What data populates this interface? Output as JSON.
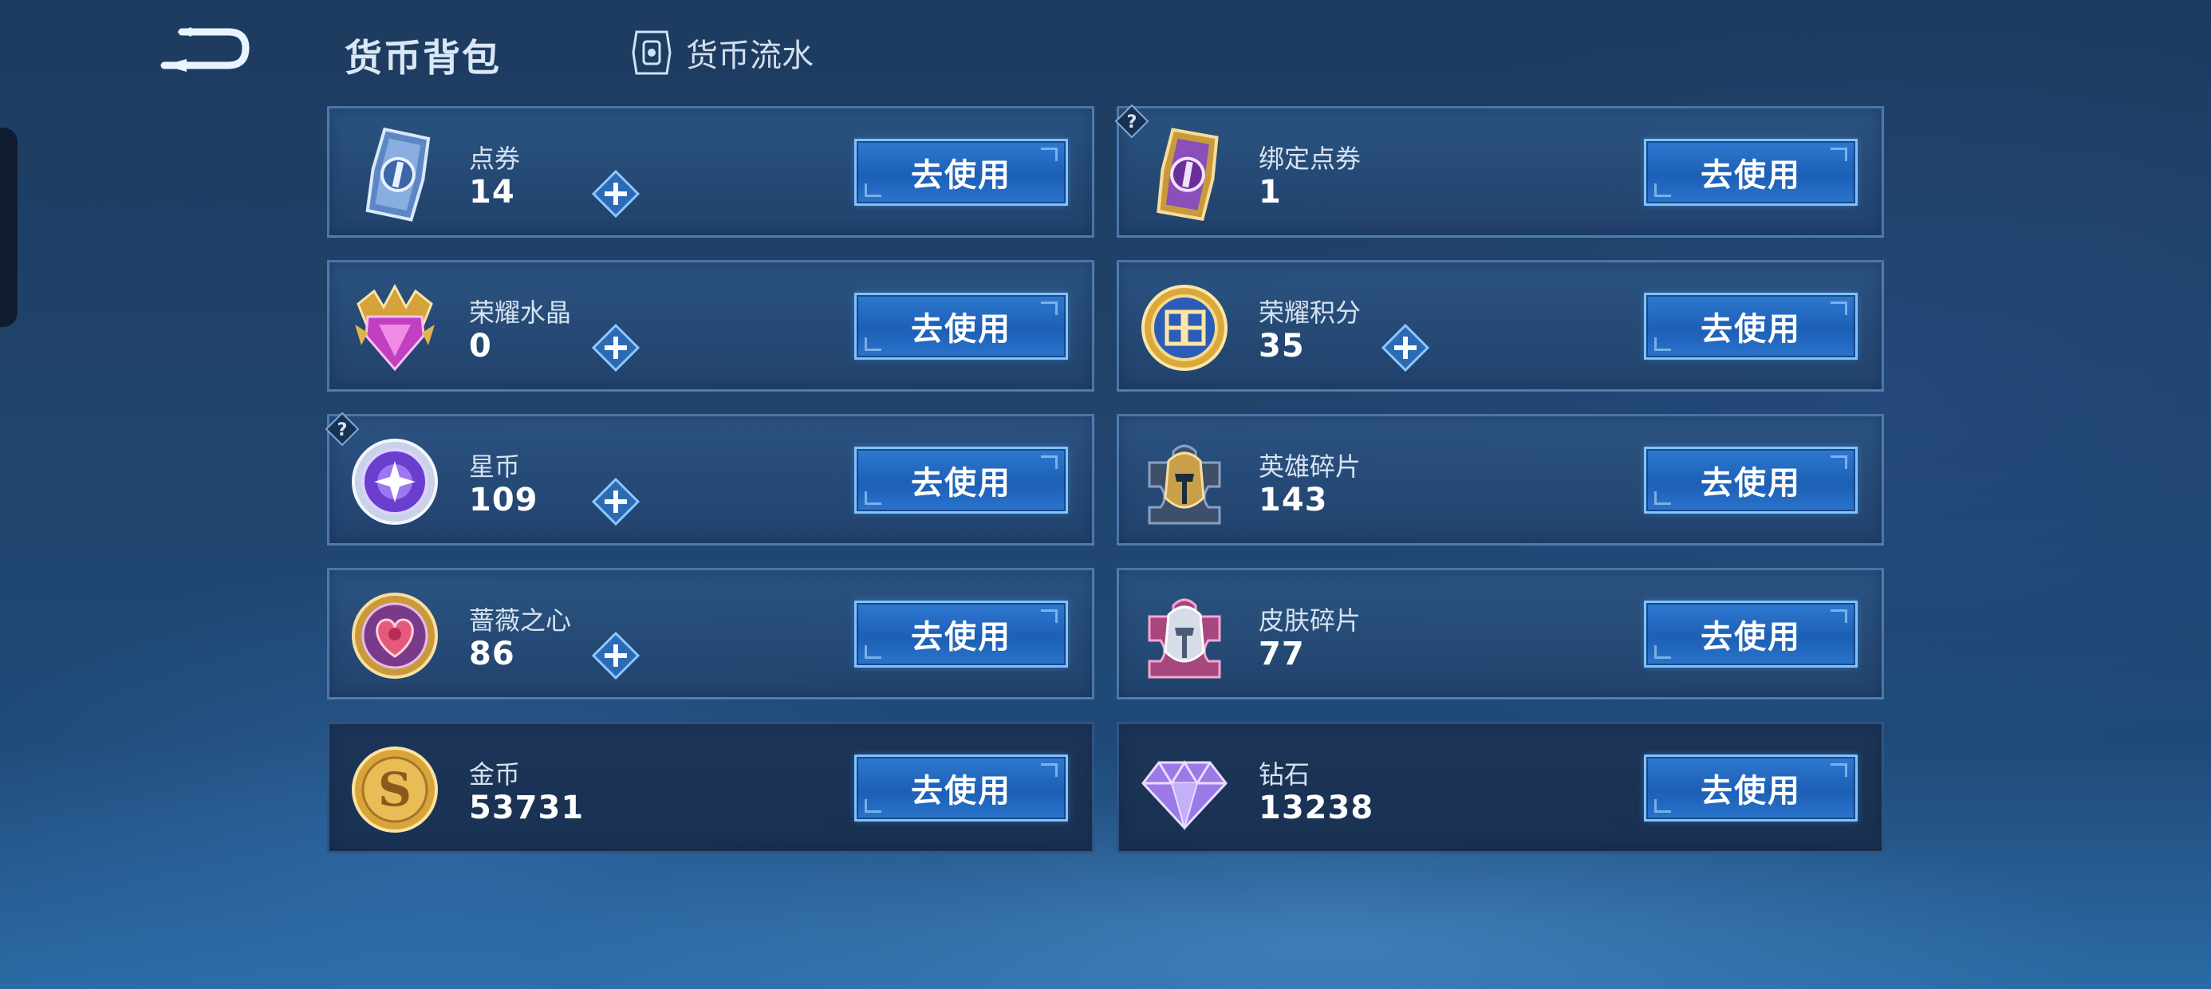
{
  "header": {
    "title": "货币背包",
    "history_tab": "货币流水"
  },
  "use_label": "去使用",
  "items": [
    {
      "name": "点券",
      "value": "14",
      "icon": "voucher-card-icon",
      "plus": true,
      "help": false
    },
    {
      "name": "绑定点券",
      "value": "1",
      "icon": "bound-voucher-card-icon",
      "plus": false,
      "help": true
    },
    {
      "name": "荣耀水晶",
      "value": "0",
      "icon": "glory-crystal-icon",
      "plus": true,
      "help": false
    },
    {
      "name": "荣耀积分",
      "value": "35",
      "icon": "glory-points-coin-icon",
      "plus": true,
      "help": false
    },
    {
      "name": "星币",
      "value": "109",
      "icon": "star-coin-icon",
      "plus": true,
      "help": true
    },
    {
      "name": "英雄碎片",
      "value": "143",
      "icon": "hero-fragment-icon",
      "plus": false,
      "help": false
    },
    {
      "name": "蔷薇之心",
      "value": "86",
      "icon": "rose-heart-icon",
      "plus": true,
      "help": false
    },
    {
      "name": "皮肤碎片",
      "value": "77",
      "icon": "skin-fragment-icon",
      "plus": false,
      "help": false
    },
    {
      "name": "金币",
      "value": "53731",
      "icon": "gold-coin-icon",
      "plus": false,
      "help": false
    },
    {
      "name": "钻石",
      "value": "13238",
      "icon": "diamond-icon",
      "plus": false,
      "help": false
    }
  ],
  "colors": {
    "accent": "#7fc2ff",
    "button": "#2467c0",
    "card": "#2c5482"
  }
}
